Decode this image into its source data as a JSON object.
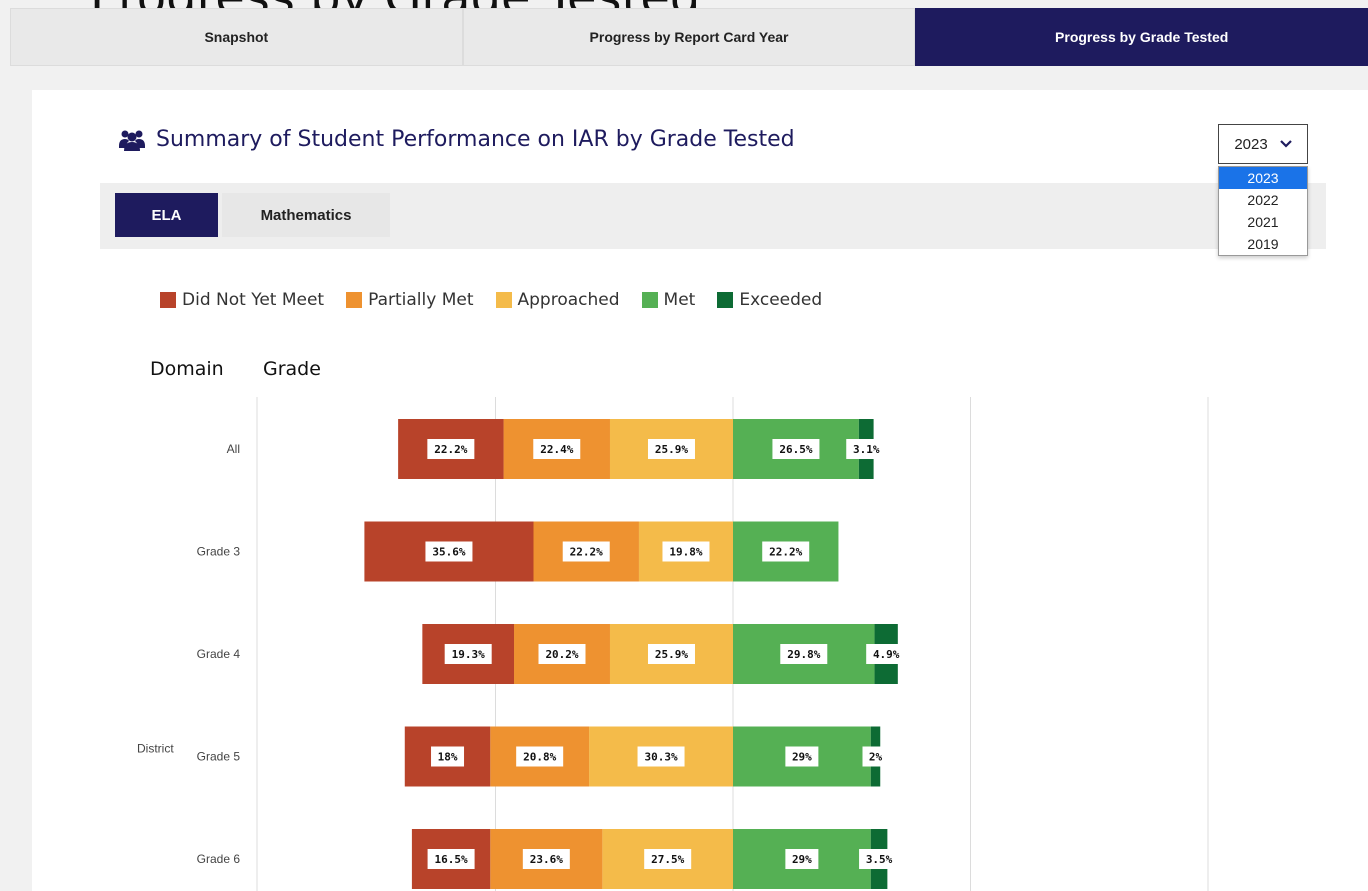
{
  "top_tabs": [
    {
      "label": "Snapshot",
      "active": false
    },
    {
      "label": "Progress by Report Card Year",
      "active": false
    },
    {
      "label": "Progress by Grade Tested",
      "active": true
    }
  ],
  "section": {
    "title": "Summary of Student Performance on IAR by Grade Tested",
    "icon": "users-icon"
  },
  "year_select": {
    "value": "2023",
    "options": [
      "2023",
      "2022",
      "2021",
      "2019"
    ],
    "selected_index": 0
  },
  "subject_tabs": [
    {
      "label": "ELA",
      "active": true
    },
    {
      "label": "Mathematics",
      "active": false
    }
  ],
  "columns": {
    "domain": "Domain",
    "grade": "Grade"
  },
  "colors": {
    "accent": "#1e1b5e",
    "select_highlight": "#1a73e8"
  },
  "chart_data": {
    "type": "bar",
    "orientation": "horizontal",
    "stacked": "diverging",
    "xlim": [
      -100,
      100
    ],
    "grid": true,
    "legend_placement": "top-left",
    "domain_label": "District",
    "categories": [
      "All",
      "Grade 3",
      "Grade 4",
      "Grade 5",
      "Grade 6"
    ],
    "series": [
      {
        "name": "Did Not Yet Meet",
        "color": "#b8432a",
        "side": "below",
        "values": [
          22.2,
          35.6,
          19.3,
          18,
          16.5
        ],
        "labels": [
          "22.2%",
          "35.6%",
          "19.3%",
          "18%",
          "16.5%"
        ]
      },
      {
        "name": "Partially Met",
        "color": "#ee9230",
        "side": "below",
        "values": [
          22.4,
          22.2,
          20.2,
          20.8,
          23.6
        ],
        "labels": [
          "22.4%",
          "22.2%",
          "20.2%",
          "20.8%",
          "23.6%"
        ]
      },
      {
        "name": "Approached",
        "color": "#f4bb4a",
        "side": "below",
        "values": [
          25.9,
          19.8,
          25.9,
          30.3,
          27.5
        ],
        "labels": [
          "25.9%",
          "19.8%",
          "25.9%",
          "30.3%",
          "27.5%"
        ]
      },
      {
        "name": "Met",
        "color": "#55b054",
        "side": "above",
        "values": [
          26.5,
          22.2,
          29.8,
          29,
          29
        ],
        "labels": [
          "26.5%",
          "22.2%",
          "29.8%",
          "29%",
          "29%"
        ]
      },
      {
        "name": "Exceeded",
        "color": "#0d6b34",
        "side": "above",
        "values": [
          3.1,
          0,
          4.9,
          2,
          3.5
        ],
        "labels": [
          "3.1%",
          "",
          "4.9%",
          "2%",
          "3.5%"
        ]
      }
    ]
  }
}
